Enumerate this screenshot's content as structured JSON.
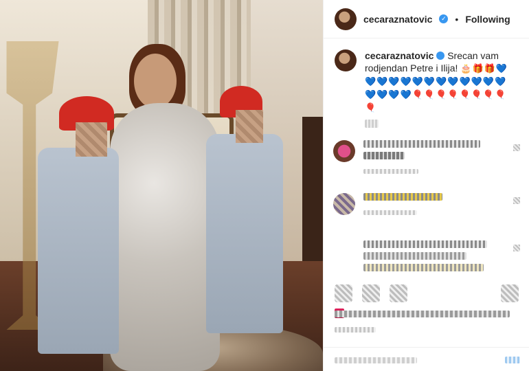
{
  "post": {
    "username": "cecaraznatovic",
    "verified_mark": "✓",
    "separator": "•",
    "follow_state": "Following",
    "caption_text": "Srecan vam rodjendan Petre i Ilija!",
    "caption_emojis": "🎂🎁🎁💙💙💙💙💙💙💙💙💙💙💙💙💙💙💙💙💙🎈🎈🎈🎈🎈🎈🎈🎈🎈"
  },
  "colors": {
    "verified": "#3897f0",
    "text": "#262626",
    "border": "#efefef",
    "like_red": "#e0245e"
  },
  "icons": [
    "more-icon",
    "heart-icon",
    "comment-icon",
    "share-icon",
    "save-icon"
  ]
}
